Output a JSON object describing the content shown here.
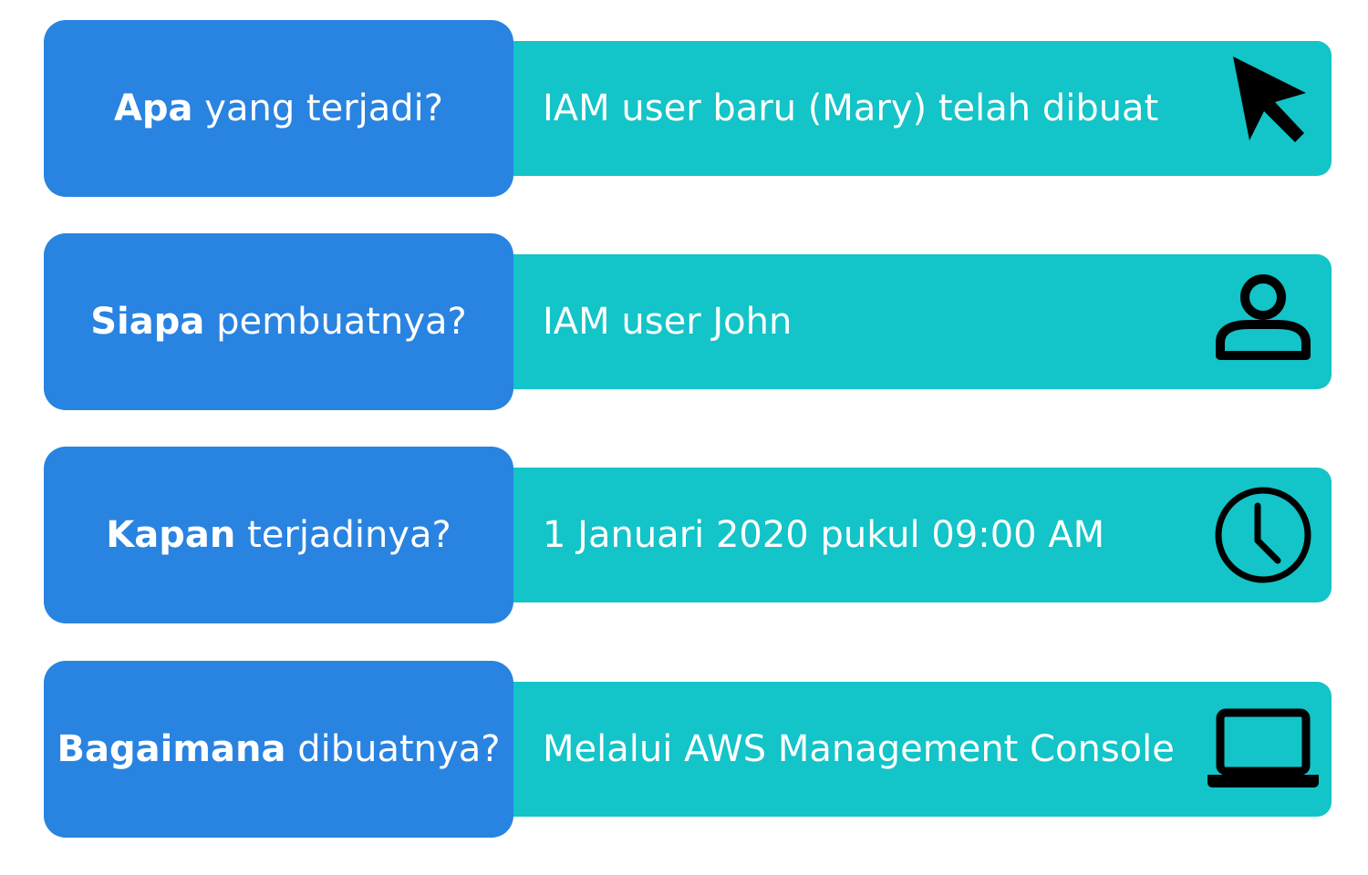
{
  "rows": [
    {
      "question_bold": "Apa",
      "question_rest": " yang terjadi?",
      "answer": "IAM user baru (Mary) telah dibuat",
      "icon": "cursor-arrow-icon"
    },
    {
      "question_bold": "Siapa",
      "question_rest": " pembuatnya?",
      "answer": "IAM user John",
      "icon": "user-icon"
    },
    {
      "question_bold": "Kapan",
      "question_rest": " terjadinya?",
      "answer": "1 Januari 2020 pukul 09:00 AM",
      "icon": "clock-icon"
    },
    {
      "question_bold": "Bagaimana",
      "question_rest": " dibuatnya?",
      "answer": "Melalui AWS Management Console",
      "icon": "laptop-icon"
    }
  ],
  "colors": {
    "question_bg": "#2983e0",
    "answer_bg": "#13c4c8",
    "text": "#ffffff",
    "icon": "#000000"
  }
}
